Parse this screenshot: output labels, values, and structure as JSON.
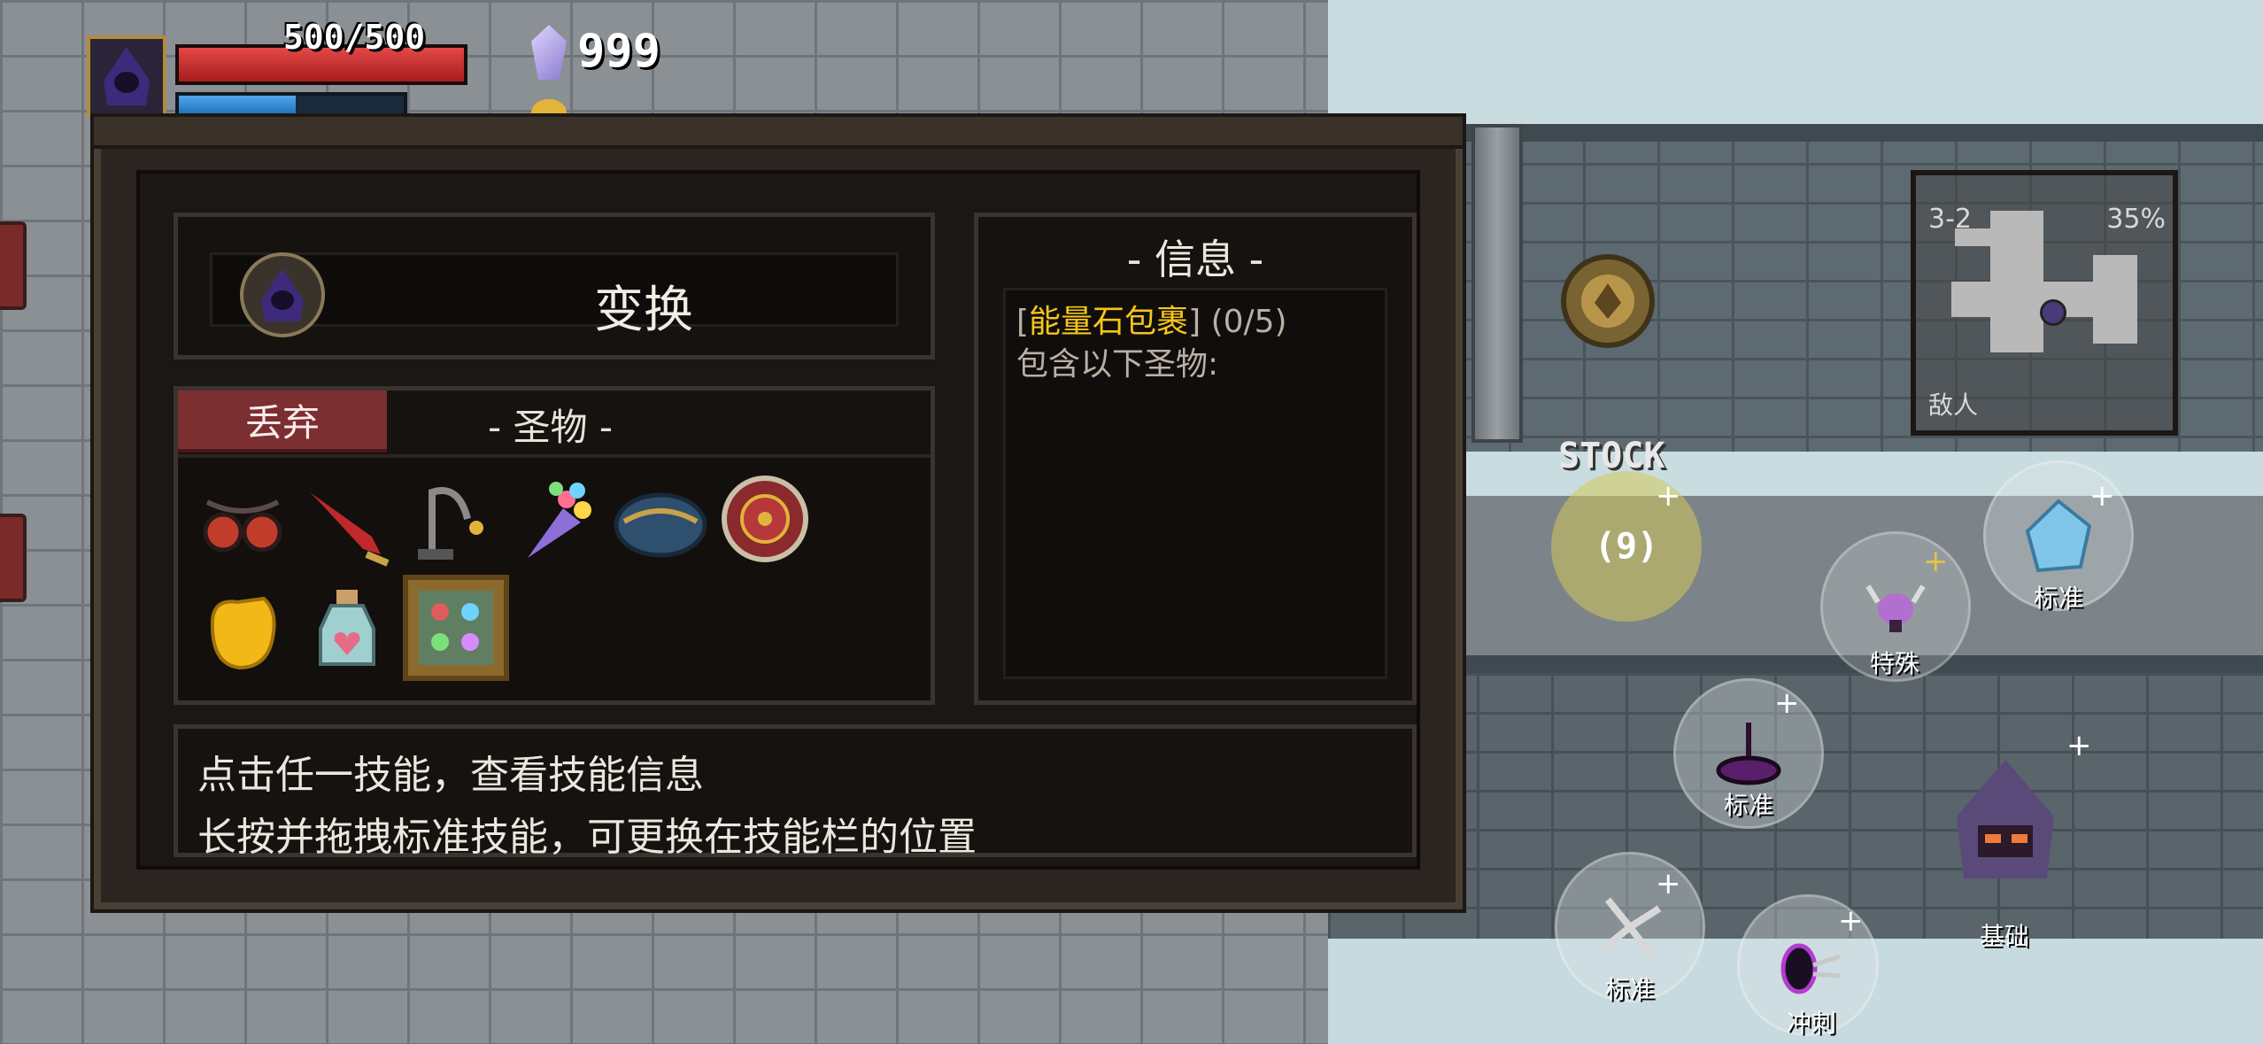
{
  "hud": {
    "hp_text": "500/500",
    "hp_fraction": 1.0,
    "mp_fraction": 0.52,
    "gems": "999",
    "colors": {
      "hp": "#d63232",
      "mp": "#3a8fd8"
    }
  },
  "panel": {
    "character_name": "变换",
    "discard_label": "丢弃",
    "relics_title": "- 圣物 -",
    "relic_icons": [
      "goggles-icon",
      "sword-icon",
      "whip-icon",
      "bouquet-icon",
      "blue-pouch-icon",
      "red-shield-icon",
      "golden-fist-icon",
      "heart-potion-icon",
      "gem-board-icon"
    ],
    "info": {
      "title": "- 信息 -",
      "bracket_open": "[",
      "item_name": "能量石包裹",
      "bracket_close": "]",
      "count": "(0/5)",
      "contains": "包含以下圣物:"
    },
    "hint_line1": "点击任一技能，查看技能信息",
    "hint_line2": "长按并拖拽标准技能，可更换在技能栏的位置",
    "colors": {
      "discard_bg": "#7b2f31",
      "highlight": "#f5c518"
    }
  },
  "minimap": {
    "level": "3-2",
    "explored": "35%",
    "enemy_label": "敌人"
  },
  "skills": {
    "stock_label": "STOCK",
    "stock_count": "(9)",
    "special_label": "特殊",
    "standard_label": "标准",
    "basic_label": "基础",
    "dash_label": "冲刺",
    "plus": "+"
  }
}
